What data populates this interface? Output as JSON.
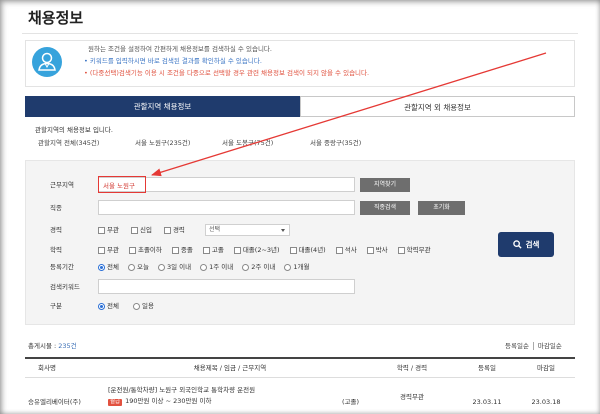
{
  "colors": {
    "navy": "#1f3b6d",
    "info_blue": "#37a3dc",
    "annotation_red": "#e53935",
    "button_gray": "#6e6e6e",
    "form_bg": "#f4f4f4"
  },
  "page": {
    "title": "채용정보"
  },
  "info": {
    "icon": "person-icon",
    "lines": [
      "원하는 조건을 설정하여 간편하게 채용정보를 검색하실 수 있습니다.",
      "• 키워드를 입력하시면 바로 검색된 결과를 확인하실 수 있습니다.",
      "• (다중선택)검색기능 이용 시 조건을 다중으로 선택할 경우 관련 채용정보 검색이 되지 않을 수 있습니다."
    ]
  },
  "tabs": [
    {
      "label": "관할지역 채용정보",
      "active": true
    },
    {
      "label": "관할지역 외 채용정보",
      "active": false
    }
  ],
  "region_summary": {
    "caption": "관할지역의 채용정보 입니다.",
    "links": [
      "관할지역 전체(345건)",
      "서울 노원구(235건)",
      "서울 도봉구(75건)",
      "서울 중랑구(35건)"
    ]
  },
  "form": {
    "area": {
      "label": "근무지역",
      "value": "서울 노원구",
      "button": "지역찾기"
    },
    "job": {
      "label": "직종",
      "search_button": "직종검색",
      "reset_button": "초기화"
    },
    "career": {
      "label": "경력",
      "options": [
        {
          "label": "무관",
          "checked": false
        },
        {
          "label": "신입",
          "checked": false
        },
        {
          "label": "경력",
          "checked": false
        }
      ],
      "select_value": "선택"
    },
    "education": {
      "label": "학력",
      "options": [
        {
          "label": "무관",
          "checked": false
        },
        {
          "label": "초졸이하",
          "checked": false
        },
        {
          "label": "중졸",
          "checked": false
        },
        {
          "label": "고졸",
          "checked": false
        },
        {
          "label": "대졸(2~3년)",
          "checked": false
        },
        {
          "label": "대졸(4년)",
          "checked": false
        },
        {
          "label": "석사",
          "checked": false
        },
        {
          "label": "박사",
          "checked": false
        },
        {
          "label": "학력무관",
          "checked": false
        }
      ]
    },
    "period": {
      "label": "등록기간",
      "options": [
        {
          "label": "전체",
          "checked": true
        },
        {
          "label": "오늘",
          "checked": false
        },
        {
          "label": "3일 이내",
          "checked": false
        },
        {
          "label": "1주 이내",
          "checked": false
        },
        {
          "label": "2주 이내",
          "checked": false
        },
        {
          "label": "1개월",
          "checked": false
        }
      ]
    },
    "keyword": {
      "label": "검색키워드"
    },
    "type": {
      "label": "구분",
      "options": [
        {
          "label": "전체",
          "checked": true
        },
        {
          "label": "일용",
          "checked": false
        }
      ]
    },
    "search_button": "검색"
  },
  "results": {
    "total_label": "총게시물 : ",
    "total_count": "235건",
    "sort": [
      "등록일순",
      "마감일순"
    ],
    "columns": [
      "회사명",
      "채용제목 / 임금 / 근무지역",
      "학력 / 경력",
      "등록일",
      "마감일"
    ],
    "rows": [
      {
        "company": "승유엘리베이터(주)",
        "title": "[운전원/통학차량] 노원구 외국인학교 통학차량 운전원",
        "wage_type": "월급",
        "wage": "190만원 이상 ~ 230만원 이하",
        "education": "(고졸)",
        "career": "경력무관",
        "registered": "23.03.11",
        "deadline": "23.03.18"
      }
    ]
  }
}
